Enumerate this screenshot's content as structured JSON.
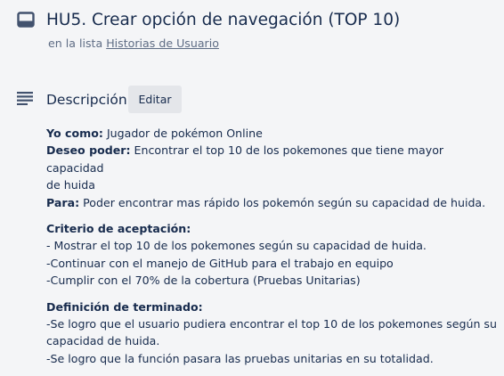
{
  "card": {
    "title": "HU5. Crear opción de navegación (TOP 10)",
    "list_prefix": "en la lista",
    "list_name": "Historias de Usuario"
  },
  "description": {
    "heading": "Descripción",
    "edit_label": "Editar",
    "yo_como_label": "Yo como:",
    "yo_como_text": " Jugador de pokémon Online",
    "deseo_label": "Deseo poder:",
    "deseo_text_1": " Encontrar el top 10 de los pokemones que tiene mayor capacidad",
    "deseo_text_2": "de huida",
    "para_label": "Para:",
    "para_text": " Poder encontrar mas rápido los pokemón según su capacidad de huida.",
    "criterio_heading": "Criterio de aceptación:",
    "criterio_items": [
      "- Mostrar el top 10 de los pokemones según su capacidad de huida.",
      "-Continuar con el manejo de GitHub para el trabajo en equipo",
      "-Cumplir con el 70% de la cobertura (Pruebas Unitarias)"
    ],
    "definicion_heading": "Definición de terminado:",
    "definicion_items": [
      "-Se logro que el usuario pudiera encontrar el top 10 de los pokemones según su",
      "capacidad de huida.",
      "-Se logro que la función pasara las pruebas unitarias en su totalidad."
    ]
  },
  "icons": {
    "card": "card-icon",
    "description": "description-lines-icon"
  },
  "colors": {
    "text": "#172b4d",
    "muted": "#5e6c84",
    "background": "#f4f5f7",
    "button": "#e4e6ea"
  }
}
